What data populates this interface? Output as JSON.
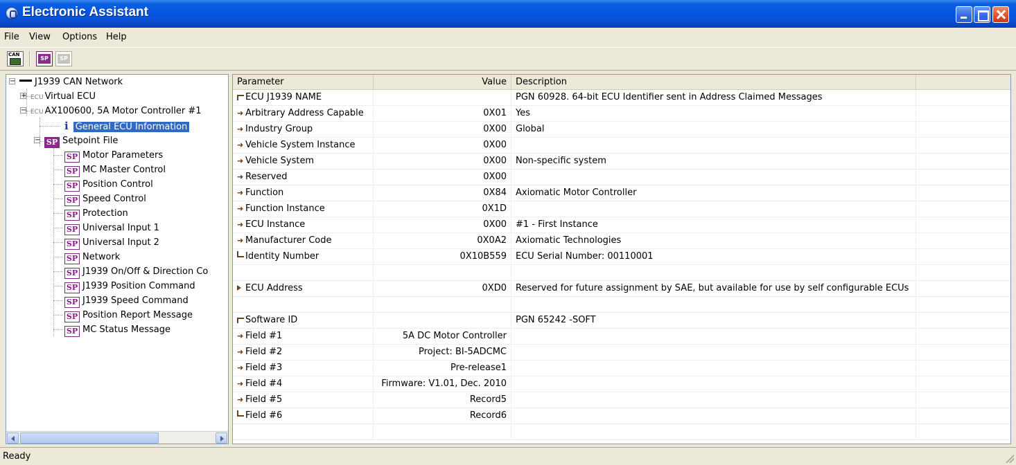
{
  "window": {
    "title": "Electronic Assistant"
  },
  "menu": {
    "items": [
      "File",
      "View",
      "Options",
      "Help"
    ]
  },
  "toolbar": {
    "can_icon_text": "CAN",
    "sp_icon_text": "SP"
  },
  "tree": {
    "ecu_tag": "ECU",
    "root": "J1939 CAN Network",
    "virtual_ecu": "Virtual ECU",
    "controller": "AX100600, 5A Motor Controller #1",
    "general_info": "General ECU Information",
    "setpoint_file": "Setpoint File",
    "sp_badge": "SP",
    "setpoints": [
      "Motor Parameters",
      "MC Master Control",
      "Position Control",
      "Speed Control",
      "Protection",
      "Universal Input 1",
      "Universal Input 2",
      "Network",
      "J1939 On/Off & Direction Co",
      "J1939 Position Command",
      "J1939 Speed Command",
      "Position Report Message",
      "MC Status Message"
    ]
  },
  "grid": {
    "columns": [
      "Parameter",
      "Value",
      "Description"
    ],
    "rows": [
      {
        "param": "ECU J1939 NAME",
        "value": "",
        "desc": "PGN 60928. 64-bit ECU Identifier sent in Address Claimed Messages",
        "mark": "top"
      },
      {
        "param": "Arbitrary Address Capable",
        "value": "0X01",
        "desc": "Yes",
        "mark": "arrow"
      },
      {
        "param": "Industry Group",
        "value": "0X00",
        "desc": "Global",
        "mark": "arrow"
      },
      {
        "param": "Vehicle System Instance",
        "value": "0X00",
        "desc": "",
        "mark": "arrow"
      },
      {
        "param": "Vehicle System",
        "value": "0X00",
        "desc": "Non-specific system",
        "mark": "arrow"
      },
      {
        "param": "Reserved",
        "value": "0X00",
        "desc": "",
        "mark": "arrow"
      },
      {
        "param": "Function",
        "value": "0X84",
        "desc": "Axiomatic Motor Controller",
        "mark": "arrow"
      },
      {
        "param": "Function Instance",
        "value": "0X1D",
        "desc": "",
        "mark": "arrow"
      },
      {
        "param": "ECU Instance",
        "value": "0X00",
        "desc": "#1 - First Instance",
        "mark": "arrow"
      },
      {
        "param": "Manufacturer Code",
        "value": "0X0A2",
        "desc": "Axiomatic Technologies",
        "mark": "arrow"
      },
      {
        "param": "Identity Number",
        "value": "0X10B559",
        "desc": "ECU Serial Number: 00110001",
        "mark": "bottom"
      },
      {
        "param": "",
        "value": "",
        "desc": "",
        "mark": "none"
      },
      {
        "param": "ECU Address",
        "value": "0XD0",
        "desc": "Reserved for future assignment by SAE, but available for use by self configurable ECUs",
        "mark": "dot"
      },
      {
        "param": "",
        "value": "",
        "desc": "",
        "mark": "none"
      },
      {
        "param": "Software ID",
        "value": "",
        "desc": "PGN 65242  -SOFT",
        "mark": "top"
      },
      {
        "param": "Field #1",
        "value": "5A DC Motor Controller",
        "desc": "",
        "mark": "arrow"
      },
      {
        "param": "Field #2",
        "value": "Project: BI-5ADCMC",
        "desc": "",
        "mark": "arrow"
      },
      {
        "param": "Field #3",
        "value": "Pre-release1",
        "desc": "",
        "mark": "arrow"
      },
      {
        "param": "Field #4",
        "value": "Firmware: V1.01, Dec. 2010",
        "desc": "",
        "mark": "arrow"
      },
      {
        "param": "Field #5",
        "value": "Record5",
        "desc": "",
        "mark": "arrow"
      },
      {
        "param": "Field #6",
        "value": "Record6",
        "desc": "",
        "mark": "bottom"
      },
      {
        "param": "",
        "value": "",
        "desc": "",
        "mark": "none"
      }
    ]
  },
  "status": {
    "text": "Ready"
  }
}
